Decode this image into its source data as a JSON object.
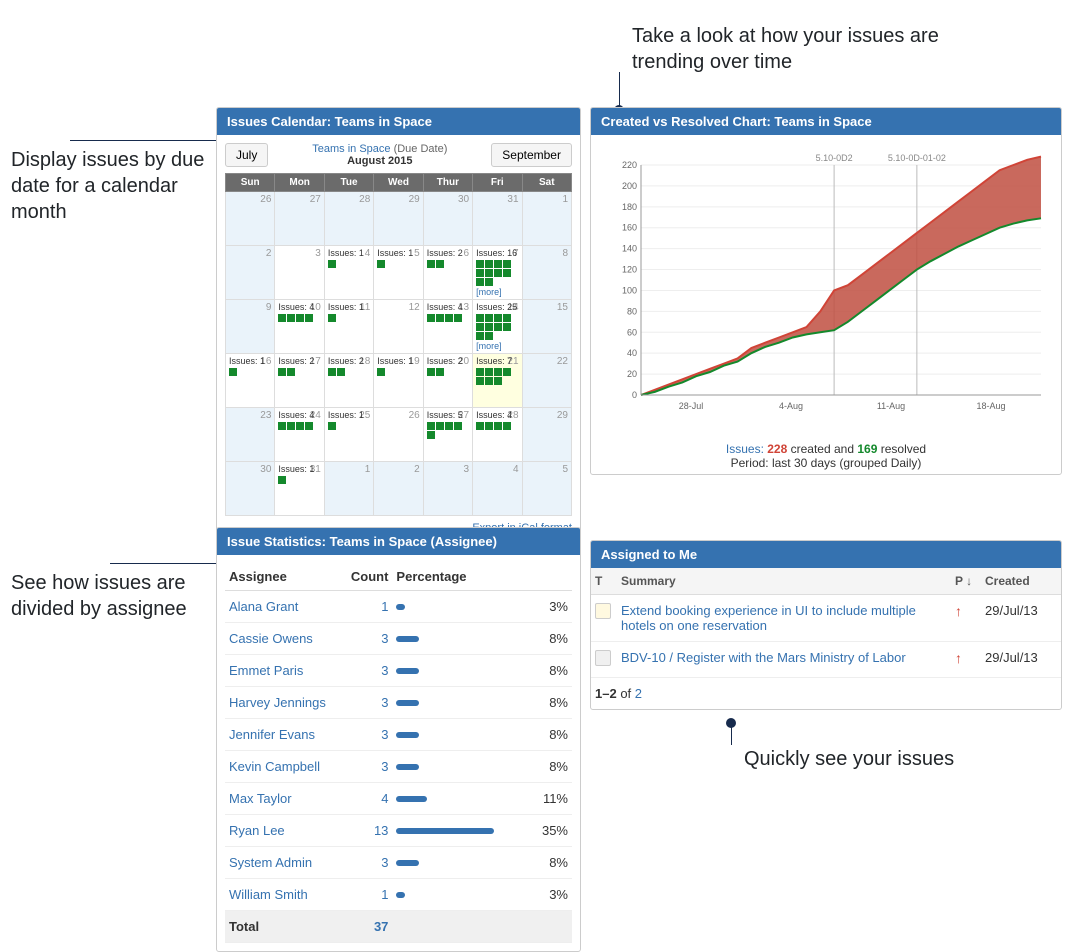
{
  "annotations": {
    "calendar": "Display issues by due date for a calendar month",
    "chart": "Take a look at how your issues are trending over time",
    "stats": "See how issues are divided by assignee",
    "assigned": "Quickly see your issues"
  },
  "calendar": {
    "header": "Issues Calendar: Teams in Space",
    "project_link": "Teams in Space",
    "project_suffix": "(Due Date)",
    "month_label": "August 2015",
    "prev_btn": "July",
    "next_btn": "September",
    "day_headers": [
      "Sun",
      "Mon",
      "Tue",
      "Wed",
      "Thur",
      "Fri",
      "Sat"
    ],
    "weeks": [
      [
        {
          "d": "26",
          "o": true
        },
        {
          "d": "27",
          "o": true
        },
        {
          "d": "28",
          "o": true
        },
        {
          "d": "29",
          "o": true
        },
        {
          "d": "30",
          "o": true
        },
        {
          "d": "31",
          "o": true
        },
        {
          "d": "1",
          "o": true
        }
      ],
      [
        {
          "d": "2",
          "o": true
        },
        {
          "d": "3"
        },
        {
          "d": "4",
          "c": 1
        },
        {
          "d": "5",
          "c": 1
        },
        {
          "d": "6",
          "c": 2
        },
        {
          "d": "7",
          "c": 16,
          "more": true
        },
        {
          "d": "8",
          "o": true
        }
      ],
      [
        {
          "d": "9",
          "o": true
        },
        {
          "d": "10",
          "c": 4
        },
        {
          "d": "11",
          "c": 1
        },
        {
          "d": "12"
        },
        {
          "d": "13",
          "c": 4
        },
        {
          "d": "14",
          "c": 25,
          "more": true
        },
        {
          "d": "15",
          "o": true
        }
      ],
      [
        {
          "d": "16",
          "c": 1
        },
        {
          "d": "17",
          "c": 2
        },
        {
          "d": "18",
          "c": 2
        },
        {
          "d": "19",
          "c": 1
        },
        {
          "d": "20",
          "c": 2
        },
        {
          "d": "21",
          "c": 7,
          "today": true
        },
        {
          "d": "22",
          "o": true
        }
      ],
      [
        {
          "d": "23",
          "o": true
        },
        {
          "d": "24",
          "c": 4
        },
        {
          "d": "25",
          "c": 1
        },
        {
          "d": "26"
        },
        {
          "d": "27",
          "c": 5
        },
        {
          "d": "28",
          "c": 4
        },
        {
          "d": "29",
          "o": true
        }
      ],
      [
        {
          "d": "30",
          "o": true
        },
        {
          "d": "31",
          "c": 1
        },
        {
          "d": "1",
          "o": true
        },
        {
          "d": "2",
          "o": true
        },
        {
          "d": "3",
          "o": true
        },
        {
          "d": "4",
          "o": true
        },
        {
          "d": "5",
          "o": true
        }
      ]
    ],
    "issues_prefix": "Issues:",
    "more_label": "[more]",
    "export_link": "Export in iCal format"
  },
  "chart": {
    "header": "Created vs Resolved Chart: Teams in Space",
    "version_labels": [
      "5.10-0D2",
      "5.10-0D-01-02"
    ],
    "footer_issues": "Issues:",
    "footer_created_n": "228",
    "footer_created_txt": "created and",
    "footer_resolved_n": "169",
    "footer_resolved_txt": "resolved",
    "period_line": "Period: last 30 days (grouped Daily)"
  },
  "chart_data": {
    "type": "area",
    "xlabel": "",
    "ylabel": "",
    "ylim": [
      0,
      220
    ],
    "y_ticks": [
      0,
      20,
      40,
      60,
      80,
      100,
      120,
      140,
      160,
      180,
      200,
      220
    ],
    "x_ticks": [
      "28-Jul",
      "4-Aug",
      "11-Aug",
      "18-Aug"
    ],
    "x_domain_days": 30,
    "series": [
      {
        "name": "Created",
        "color": "#d04437",
        "values": [
          0,
          5,
          10,
          15,
          20,
          25,
          30,
          35,
          45,
          50,
          55,
          60,
          65,
          80,
          100,
          105,
          115,
          125,
          135,
          145,
          155,
          165,
          175,
          185,
          195,
          205,
          215,
          220,
          225,
          228
        ]
      },
      {
        "name": "Resolved",
        "color": "#14892c",
        "values": [
          0,
          3,
          8,
          12,
          18,
          22,
          28,
          32,
          40,
          46,
          50,
          55,
          58,
          60,
          62,
          70,
          80,
          90,
          100,
          110,
          120,
          128,
          135,
          142,
          148,
          154,
          160,
          164,
          167,
          169
        ]
      }
    ],
    "version_markers": [
      {
        "label": "5.10-0D2",
        "x_index": 14
      },
      {
        "label": "5.10-0D-01-02",
        "x_index": 20
      }
    ]
  },
  "stats": {
    "header": "Issue Statistics: Teams in Space (Assignee)",
    "col_assignee": "Assignee",
    "col_count": "Count",
    "col_pct": "Percentage",
    "rows": [
      {
        "name": "Alana Grant",
        "count": 1,
        "pct": "3%",
        "w": 3
      },
      {
        "name": "Cassie Owens",
        "count": 3,
        "pct": "8%",
        "w": 8
      },
      {
        "name": "Emmet Paris",
        "count": 3,
        "pct": "8%",
        "w": 8
      },
      {
        "name": "Harvey Jennings",
        "count": 3,
        "pct": "8%",
        "w": 8
      },
      {
        "name": "Jennifer Evans",
        "count": 3,
        "pct": "8%",
        "w": 8
      },
      {
        "name": "Kevin Campbell",
        "count": 3,
        "pct": "8%",
        "w": 8
      },
      {
        "name": "Max Taylor",
        "count": 4,
        "pct": "11%",
        "w": 11
      },
      {
        "name": "Ryan Lee",
        "count": 13,
        "pct": "35%",
        "w": 35
      },
      {
        "name": "System Admin",
        "count": 3,
        "pct": "8%",
        "w": 8
      },
      {
        "name": "William Smith",
        "count": 1,
        "pct": "3%",
        "w": 3
      }
    ],
    "total_label": "Total",
    "total_count": "37"
  },
  "assigned": {
    "header": "Assigned to Me",
    "col_t": "T",
    "col_summary": "Summary",
    "col_p": "P",
    "col_created": "Created",
    "rows": [
      {
        "type": "t1",
        "summary": "Extend booking experience in UI to include multiple hotels on one reservation",
        "created": "29/Jul/13"
      },
      {
        "type": "t2",
        "key": "BDV-10",
        "summary": "Register with the Mars Ministry of Labor",
        "created": "29/Jul/13"
      }
    ],
    "footer_range": "1–2",
    "footer_of": " of ",
    "footer_total": "2"
  }
}
